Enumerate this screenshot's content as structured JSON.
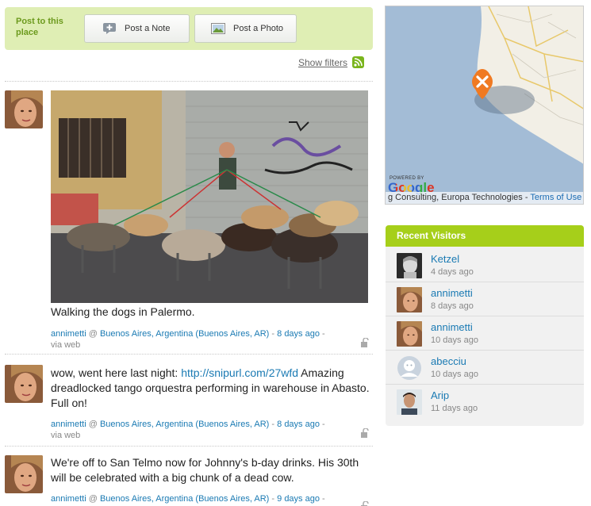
{
  "post_bar": {
    "label": "Post to this place",
    "note_button": "Post a Note",
    "photo_button": "Post a Photo"
  },
  "filters": {
    "show_filters": "Show filters"
  },
  "entries": [
    {
      "caption": "Walking the dogs in Palermo.",
      "user": "annimetti",
      "at": "@",
      "place": "Buenos Aires, Argentina (Buenos Aires, AR)",
      "time": "8 days ago",
      "sep": "-",
      "via": "via web"
    },
    {
      "text_before": "wow, went here last night: ",
      "link": "http://snipurl.com/27wfd",
      "text_after": " Amazing dreadlocked tango orquestra performing in warehouse in Abasto. Full on!",
      "user": "annimetti",
      "at": "@",
      "place": "Buenos Aires, Argentina (Buenos Aires, AR)",
      "time": "8 days ago",
      "sep": "-",
      "via": "via web"
    },
    {
      "text": "We're off to San Telmo now for Johnny's b-day drinks. His 30th will be celebrated with a big chunk of a dead cow.",
      "user": "annimetti",
      "at": "@",
      "place": "Buenos Aires, Argentina (Buenos Aires, AR)",
      "time": "9 days ago",
      "sep": "-"
    }
  ],
  "map": {
    "powered_by": "POWERED BY",
    "google": "Google",
    "credit": "g Consulting, Europa Technologies - ",
    "terms": "Terms of Use"
  },
  "visitors": {
    "title": "Recent Visitors",
    "items": [
      {
        "name": "Ketzel",
        "time": "4 days ago"
      },
      {
        "name": "annimetti",
        "time": "8 days ago"
      },
      {
        "name": "annimetti",
        "time": "10 days ago"
      },
      {
        "name": "abecciu",
        "time": "10 days ago"
      },
      {
        "name": "Arip",
        "time": "11 days ago"
      }
    ]
  },
  "colors": {
    "accent_green": "#a6cf1a",
    "post_bar_bg": "#dfeeb4",
    "link_blue": "#1a7ab3",
    "water": "#a3bcd6"
  }
}
